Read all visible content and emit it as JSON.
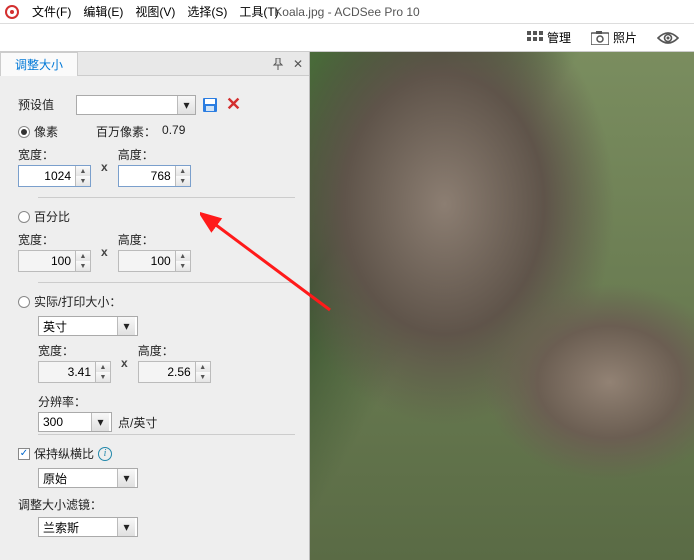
{
  "title": "Koala.jpg - ACDSee Pro 10",
  "menu": [
    "文件(F)",
    "编辑(E)",
    "视图(V)",
    "选择(S)",
    "工具(T)"
  ],
  "toolbar": {
    "manage": "管理",
    "photo": "照片"
  },
  "panel": {
    "tab": "调整大小",
    "preset_label": "预设值",
    "preset_value": "",
    "pixels": {
      "label": "像素",
      "mega_label": "百万像素：",
      "mega_value": "0.79",
      "width_label": "宽度：",
      "height_label": "高度：",
      "width": "1024",
      "height": "768"
    },
    "percent": {
      "label": "百分比",
      "width_label": "宽度：",
      "height_label": "高度：",
      "width": "100",
      "height": "100"
    },
    "print": {
      "label": "实际/打印大小：",
      "unit": "英寸",
      "width_label": "宽度：",
      "height_label": "高度：",
      "width": "3.41",
      "height": "2.56",
      "res_label": "分辨率：",
      "res_value": "300",
      "res_unit": "点/英寸"
    },
    "aspect": {
      "label": "保持纵横比",
      "value": "原始"
    },
    "filter": {
      "label": "调整大小滤镜：",
      "value": "兰索斯"
    }
  }
}
